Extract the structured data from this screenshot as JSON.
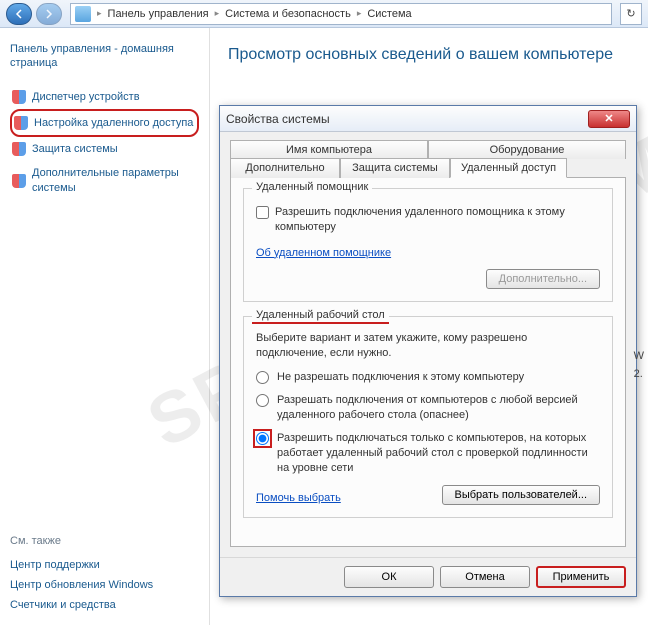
{
  "breadcrumb": {
    "item1": "Панель управления",
    "item2": "Система и безопасность",
    "item3": "Система"
  },
  "sidebar": {
    "title": "Панель управления - домашняя страница",
    "links": [
      {
        "label": "Диспетчер устройств"
      },
      {
        "label": "Настройка удаленного доступа"
      },
      {
        "label": "Защита системы"
      },
      {
        "label": "Дополнительные параметры системы"
      }
    ],
    "footer_head": "См. также",
    "footer_links": [
      {
        "label": "Центр поддержки"
      },
      {
        "label": "Центр обновления Windows"
      },
      {
        "label": "Счетчики и средства"
      }
    ]
  },
  "page": {
    "title": "Просмотр основных сведений о вашем компьютере"
  },
  "dialog": {
    "title": "Свойства системы",
    "tabs_back": [
      {
        "label": "Имя компьютера"
      },
      {
        "label": "Оборудование"
      }
    ],
    "tabs_front": [
      {
        "label": "Дополнительно"
      },
      {
        "label": "Защита системы"
      },
      {
        "label": "Удаленный доступ"
      }
    ],
    "assist": {
      "legend": "Удаленный помощник",
      "checkbox": "Разрешить подключения удаленного помощника к этому компьютеру",
      "link": "Об удаленном помощнике",
      "more_btn": "Дополнительно..."
    },
    "remote": {
      "legend": "Удаленный рабочий стол",
      "desc": "Выберите вариант и затем укажите, кому разрешено подключение, если нужно.",
      "opt1": "Не разрешать подключения к этому компьютеру",
      "opt2": "Разрешать подключения от компьютеров с любой версией удаленного рабочего стола (опаснее)",
      "opt3": "Разрешить подключаться только с компьютеров, на которых работает удаленный рабочий стол с проверкой подлинности на уровне сети",
      "help_link": "Помочь выбрать",
      "users_btn": "Выбрать пользователей..."
    },
    "buttons": {
      "ok": "ОК",
      "cancel": "Отмена",
      "apply": "Применить"
    }
  },
  "watermark": "SPVCOMP.COM",
  "hints": {
    "w": "W",
    "two": "2."
  }
}
